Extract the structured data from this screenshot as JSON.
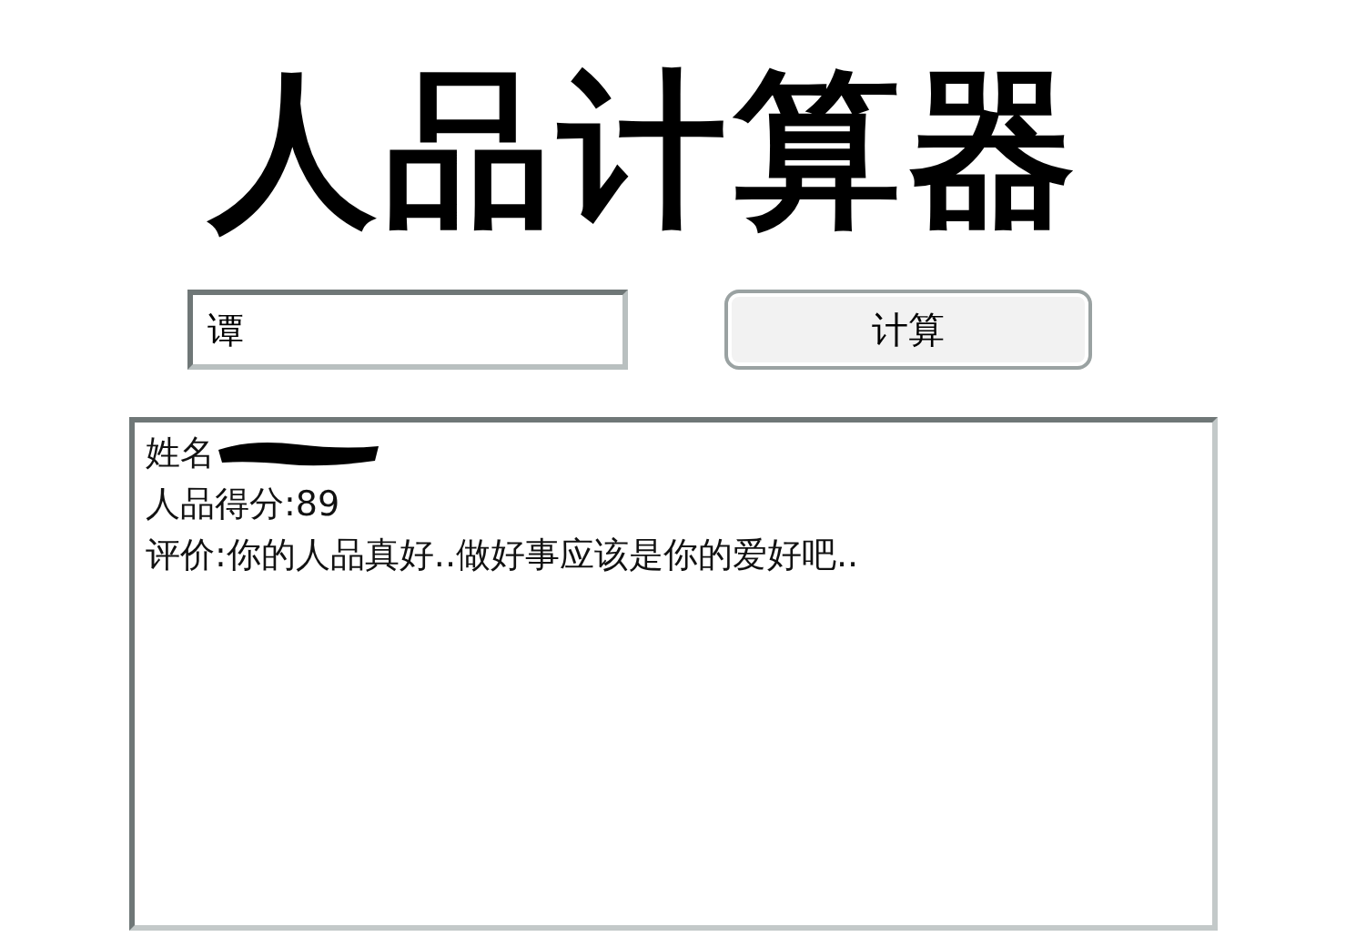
{
  "title": "人品计算器",
  "name_input": {
    "value": "谭"
  },
  "calculate_button": {
    "label": "计算"
  },
  "result": {
    "lines": [
      {
        "label": "姓名",
        "redacted": true
      },
      {
        "label": "人品得分:89",
        "redacted": false
      },
      {
        "label": "评价:你的人品真好..做好事应该是你的爱好吧..",
        "redacted": false
      }
    ]
  }
}
